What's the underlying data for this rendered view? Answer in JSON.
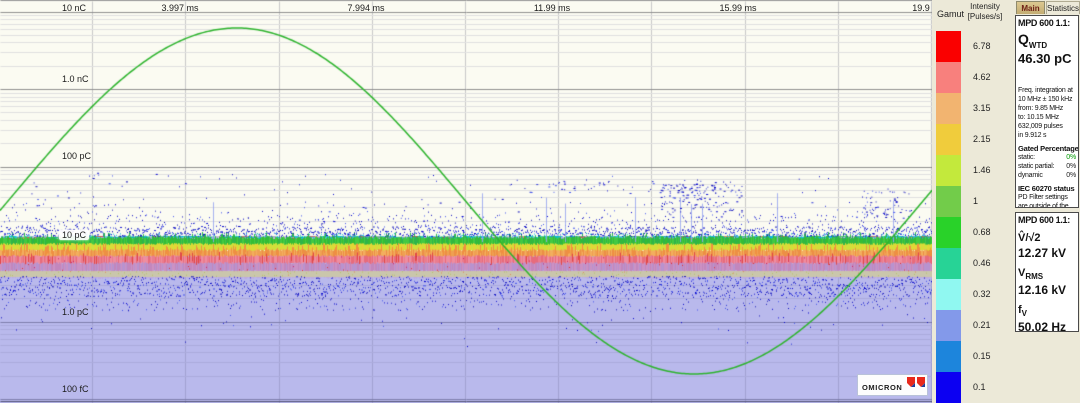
{
  "plot": {
    "x_tick_labels": [
      "3.997 ms",
      "7.994 ms",
      "11.99 ms",
      "15.99 ms",
      "19.9"
    ],
    "y_tick_labels": [
      "10 nC",
      "1.0 nC",
      "100 pC",
      "10 pC",
      "1.0 pC",
      "100 fC"
    ],
    "background_upper": "#fbfbf2",
    "background_lower": "#b9b9ec",
    "sine_color": "#2db42d"
  },
  "gamut": {
    "title": "Gamut",
    "intensity_label_line1": "Intensity",
    "intensity_label_line2": "[Pulses/s]",
    "segments": [
      {
        "value": "6.78",
        "color": "#fa0000"
      },
      {
        "value": "4.62",
        "color": "#f8807d"
      },
      {
        "value": "3.15",
        "color": "#f2b470"
      },
      {
        "value": "2.15",
        "color": "#f0cc3c"
      },
      {
        "value": "1.46",
        "color": "#c3e93c"
      },
      {
        "value": "1",
        "color": "#72cc4a"
      },
      {
        "value": "0.68",
        "color": "#29d229"
      },
      {
        "value": "0.46",
        "color": "#27d396"
      },
      {
        "value": "0.32",
        "color": "#90f8f1"
      },
      {
        "value": "0.21",
        "color": "#8399ea"
      },
      {
        "value": "0.15",
        "color": "#1d85dc"
      },
      {
        "value": "0.1",
        "color": "#0c00f2"
      }
    ]
  },
  "tabs": [
    {
      "label": "Main",
      "active": true
    },
    {
      "label": "Statistics",
      "active": false
    }
  ],
  "panel_top": {
    "title": "MPD 600 1.1:",
    "metric_symbol": "Q",
    "metric_sub": "WTD",
    "metric_value": "46.30 pC",
    "freq_lines": [
      "Freq. integration at",
      "10 MHz ± 150 kHz",
      "from:  9.85 MHz",
      "to:     10.15 MHz",
      "632,009 pulses",
      "in 9.912 s"
    ],
    "gated_title": "Gated Percentage",
    "gated_rows": [
      {
        "label": "static:",
        "value": "0%",
        "color": "#009900"
      },
      {
        "label": "static partial:",
        "value": "0%",
        "color": "#1a1a1a"
      },
      {
        "label": "dynamic",
        "value": "0%",
        "color": "#1a1a1a"
      }
    ],
    "iec_title": "IEC 60270 status",
    "iec_text": "PD Filter settings are outside of the recommended range."
  },
  "panel_bottom": {
    "title": "MPD 600 1.1:",
    "rows": [
      {
        "symbol": "V̂/√2",
        "sub": "",
        "value": "12.27 kV"
      },
      {
        "symbol": "V",
        "sub": "RMS",
        "value": "12.16 kV"
      },
      {
        "symbol": "f",
        "sub": "V",
        "value": "50.02 Hz"
      }
    ]
  },
  "logo": {
    "text": "OMICRON"
  },
  "chart_data": {
    "type": "heatmap",
    "x": {
      "unit": "ms",
      "range": [
        0,
        19.99
      ],
      "ticks": [
        "3.997 ms",
        "7.994 ms",
        "11.99 ms",
        "15.99 ms",
        "19.9"
      ]
    },
    "y": {
      "scale": "log",
      "unit": "charge",
      "ticks": [
        "10 nC",
        "1.0 nC",
        "100 pC",
        "10 pC",
        "1.0 pC",
        "100 fC"
      ]
    },
    "legend": {
      "title": "Intensity [Pulses/s]",
      "levels": [
        6.78,
        4.62,
        3.15,
        2.15,
        1.46,
        1,
        0.68,
        0.46,
        0.32,
        0.21,
        0.15,
        0.1
      ]
    },
    "series": [
      {
        "name": "AC voltage reference",
        "type": "line",
        "shape": "sine",
        "frequency_hz": 50.02,
        "periods_shown": 1
      }
    ],
    "features": [
      "continuous rainbow noise/PD band centered near 10 pC across the full cycle",
      "scattered blue pulse clusters between ~20 pC and ~100 pC around 11-16 ms and near 19 ms",
      "sparse blue speckle floor between ~1 pC and ~6 pC on lavender background"
    ]
  }
}
